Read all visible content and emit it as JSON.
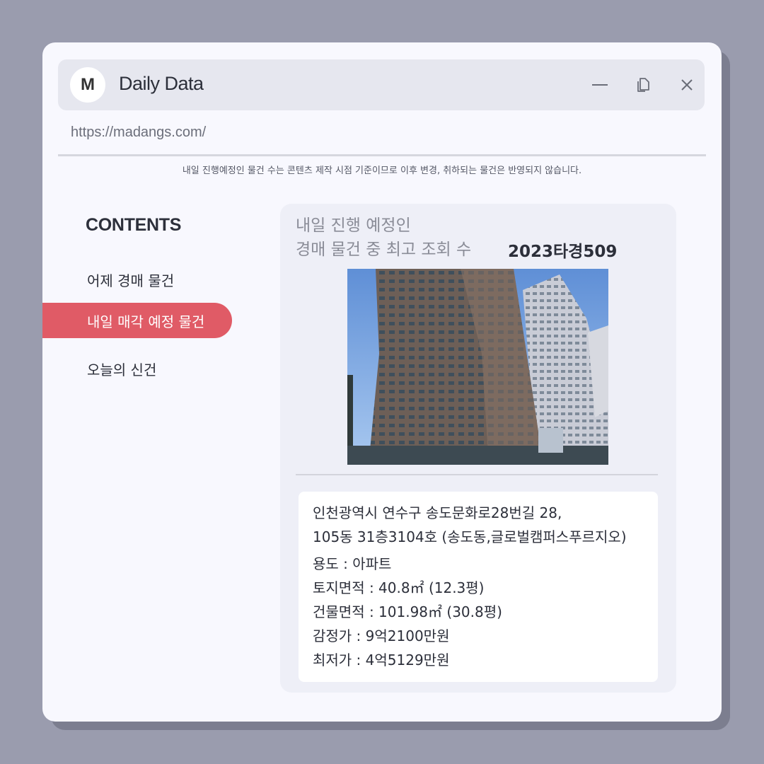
{
  "window": {
    "logo_letter": "M",
    "title": "Daily Data",
    "url": "https://madangs.com/",
    "controls": {
      "minimize": "minimize-icon",
      "restore": "restore-icon",
      "close": "close-icon"
    }
  },
  "notice": "내일 진행예정인 물건 수는 콘텐츠 제작 시점 기준이므로 이후 변경, 취하되는 물건은 반영되지 않습니다.",
  "sidebar": {
    "title": "CONTENTS",
    "items": [
      {
        "label": "어제 경매 물건",
        "active": false
      },
      {
        "label": "내일 매각 예정 물건",
        "active": true
      },
      {
        "label": "오늘의 신건",
        "active": false
      }
    ]
  },
  "card": {
    "heading_line1": "내일 진행 예정인",
    "heading_line2": "경매 물건 중 최고 조회 수",
    "case_number": "2023타경509",
    "address_line1": "인천광역시 연수구 송도문화로28번길 28,",
    "address_line2": "105동 31층3104호 (송도동,글로벌캠퍼스푸르지오)",
    "usage": "용도 : 아파트",
    "land_area": "토지면적 : 40.8㎡ (12.3평)",
    "building_area": "건물면적 : 101.98㎡ (30.8평)",
    "appraisal": "감정가 : 9억2100만원",
    "minimum_price": "최저가 : 4억5129만원"
  },
  "colors": {
    "background": "#9a9cae",
    "window": "#f8f8fe",
    "accent": "#e05b66",
    "card": "#eeeff7"
  }
}
